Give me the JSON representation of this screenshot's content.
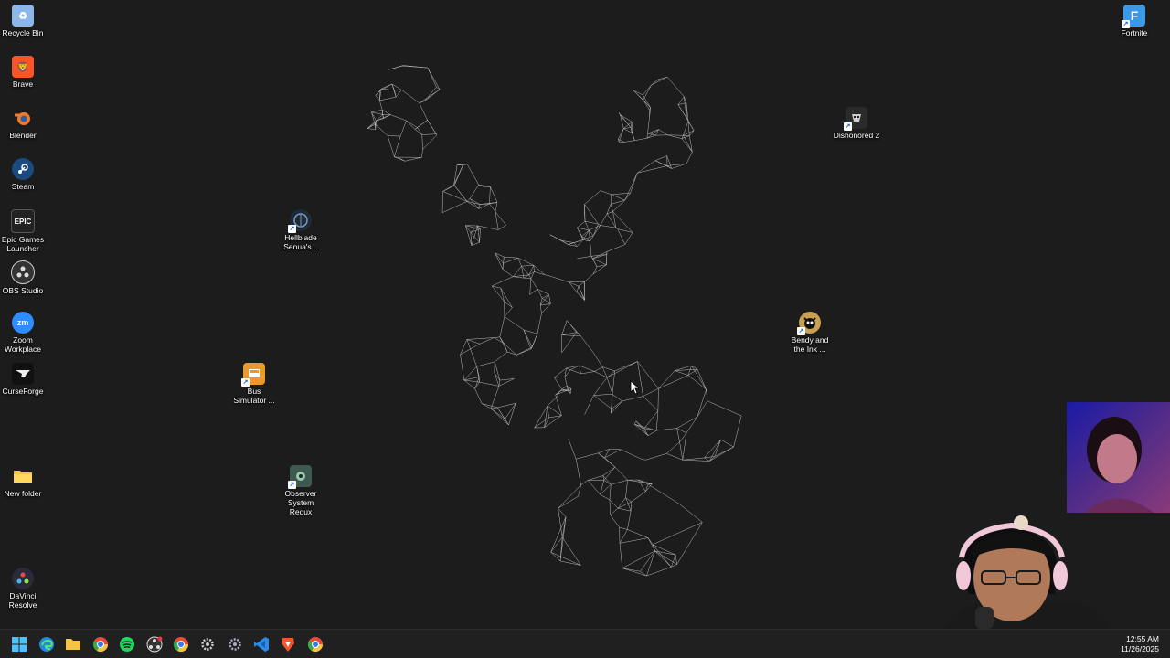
{
  "desktop": {
    "icons": [
      {
        "label": "Recycle Bin",
        "icon": "recycle-bin-icon",
        "color": "#6aa8e8"
      },
      {
        "label": "Brave",
        "icon": "brave-icon",
        "color": "#fb542b"
      },
      {
        "label": "Blender",
        "icon": "blender-icon",
        "color": "#f5792a"
      },
      {
        "label": "Steam",
        "icon": "steam-icon",
        "color": "#1b2838"
      },
      {
        "label": "Epic Games\nLauncher",
        "icon": "epic-games-icon",
        "color": "#2a2a2a"
      },
      {
        "label": "OBS Studio",
        "icon": "obs-icon",
        "color": "#302e31"
      },
      {
        "label": "Zoom\nWorkplace",
        "icon": "zoom-icon",
        "color": "#2d8cff"
      },
      {
        "label": "CurseForge",
        "icon": "curseforge-icon",
        "color": "#1a1a1a"
      },
      {
        "label": "New folder",
        "icon": "folder-icon",
        "color": "#f5c542"
      },
      {
        "label": "DaVinci\nResolve",
        "icon": "davinci-resolve-icon",
        "color": "#3a3a4a"
      },
      {
        "label": "Hellblade\nSenua's...",
        "icon": "hellblade-icon",
        "color": "#3a4a5a"
      },
      {
        "label": "Bus\nSimulator ...",
        "icon": "bus-simulator-icon",
        "color": "#e8a23a"
      },
      {
        "label": "Observer\nSystem\nRedux",
        "icon": "observer-icon",
        "color": "#5a7a6a"
      },
      {
        "label": "Dishonored 2",
        "icon": "dishonored-icon",
        "color": "#4a4a4a"
      },
      {
        "label": "Bendy and\nthe Ink ...",
        "icon": "bendy-icon",
        "color": "#c8a050"
      },
      {
        "label": "Fortnite",
        "icon": "fortnite-icon",
        "color": "#3a9ae8"
      }
    ]
  },
  "taskbar": {
    "apps": [
      "start-icon",
      "edge-icon",
      "file-explorer-icon",
      "chrome-icon",
      "spotify-icon",
      "obs-icon",
      "chrome-icon",
      "settings-gear-icon",
      "settings-gear-icon",
      "vscode-icon",
      "brave-icon",
      "chrome-icon"
    ],
    "time": "12:55 AM",
    "date": "11/26/2025"
  }
}
